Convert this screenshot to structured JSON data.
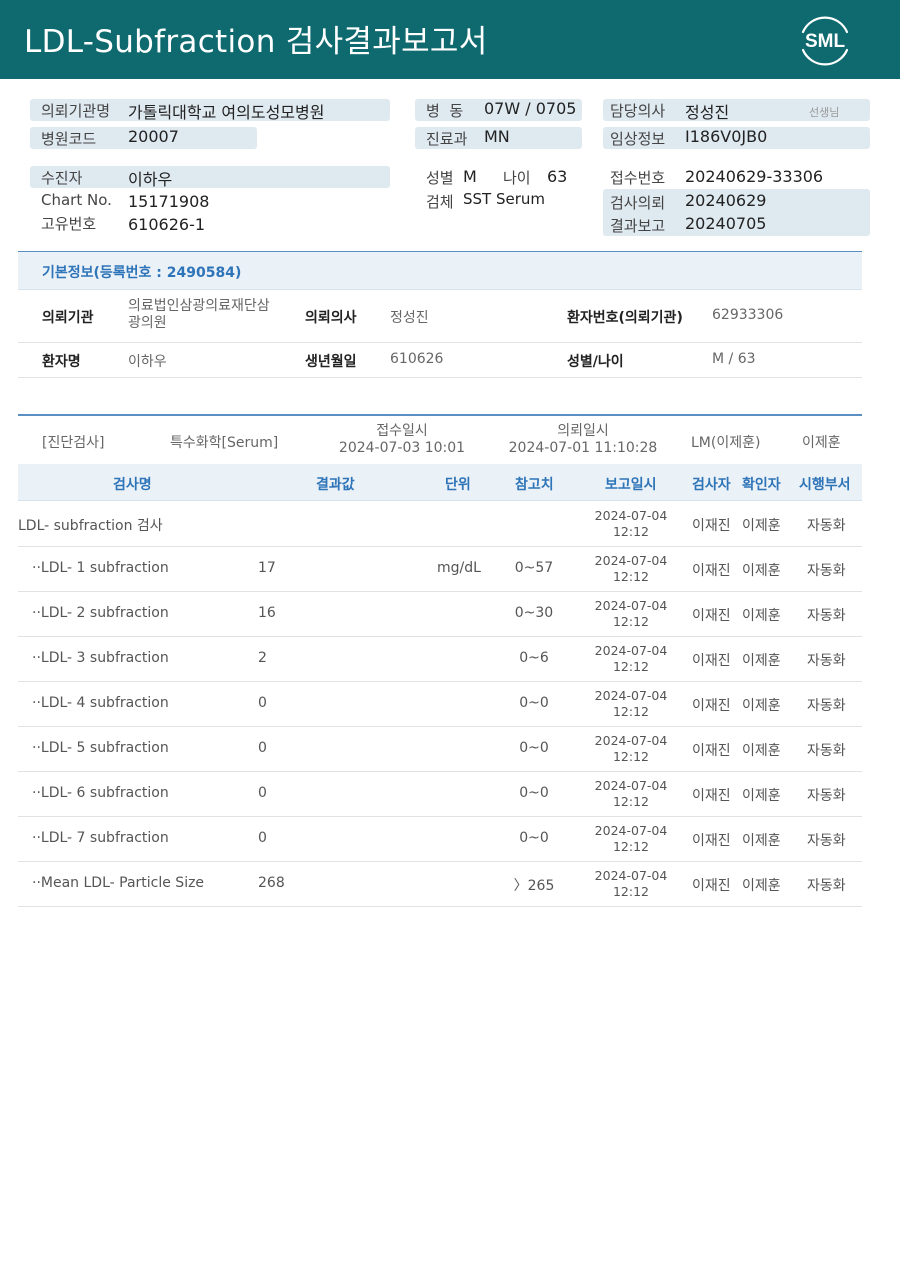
{
  "report": {
    "title": "LDL-Subfraction 검사결과보고서",
    "logo_text": "SML",
    "header_color": "#0e6a6f"
  },
  "info": {
    "hospital_label": "의뢰기관명",
    "hospital": "가톨릭대학교 여의도성모병원",
    "code_label": "병원코드",
    "code": "20007",
    "ward_label": "병  동",
    "ward": "07W / 0705",
    "dept_label": "진료과",
    "dept": "MN",
    "doctor_label": "담당의사",
    "doctor": "정성진",
    "doctor_suffix": "선생님",
    "clinical_label": "임상정보",
    "clinical": "I186V0JB0",
    "patient_label": "수진자",
    "patient": "이하우",
    "chart_label": "Chart No.",
    "chart": "15171908",
    "unique_label": "고유번호",
    "unique": "610626-1",
    "sex_label": "성별",
    "sex": "M",
    "age_label": "나이",
    "age": "63",
    "specimen_label": "검체",
    "specimen": "SST Serum",
    "receipt_label": "접수번호",
    "receipt": "20240629-33306",
    "request_label": "검사의뢰",
    "request": "20240629",
    "result_label": "결과보고",
    "result": "20240705"
  },
  "basic": {
    "header": "기본정보(등록번호 : 2490584)",
    "org_label": "의뢰기관",
    "org": "의료법인삼광의료재단삼",
    "org2": "광의원",
    "req_doc_label": "의뢰의사",
    "req_doc": "정성진",
    "pt_no_label": "환자번호(의뢰기관)",
    "pt_no": "62933306",
    "name_label": "환자명",
    "name": "이하우",
    "birth_label": "생년월일",
    "birth": "610626",
    "sexage_label": "성별/나이",
    "sexage": "M / 63"
  },
  "exam": {
    "category": "[진단검사]",
    "type": "특수화학[Serum]",
    "received_label": "접수일시",
    "received": "2024-07-03 10:01",
    "requested_label": "의뢰일시",
    "requested": "2024-07-01 11:10:28",
    "lm": "LM(이제훈)",
    "lm_name": "이제훈"
  },
  "table": {
    "headers": [
      "검사명",
      "결과값",
      "단위",
      "참고치",
      "보고일시",
      "검사자",
      "확인자",
      "시행부서"
    ],
    "rows": [
      {
        "name": "LDL- subfraction 검사",
        "result": "",
        "unit": "",
        "ref": "",
        "date": "2024-07-04",
        "time": "12:12",
        "tester": "이재진",
        "checker": "이제훈",
        "dept": "자동화"
      },
      {
        "name": "··LDL- 1 subfraction",
        "result": "17",
        "unit": "mg/dL",
        "ref": "0~57",
        "date": "2024-07-04",
        "time": "12:12",
        "tester": "이재진",
        "checker": "이제훈",
        "dept": "자동화"
      },
      {
        "name": "··LDL- 2 subfraction",
        "result": "16",
        "unit": "",
        "ref": "0~30",
        "date": "2024-07-04",
        "time": "12:12",
        "tester": "이재진",
        "checker": "이제훈",
        "dept": "자동화"
      },
      {
        "name": "··LDL- 3 subfraction",
        "result": "2",
        "unit": "",
        "ref": "0~6",
        "date": "2024-07-04",
        "time": "12:12",
        "tester": "이재진",
        "checker": "이제훈",
        "dept": "자동화"
      },
      {
        "name": "··LDL- 4 subfraction",
        "result": "0",
        "unit": "",
        "ref": "0~0",
        "date": "2024-07-04",
        "time": "12:12",
        "tester": "이재진",
        "checker": "이제훈",
        "dept": "자동화"
      },
      {
        "name": "··LDL- 5 subfraction",
        "result": "0",
        "unit": "",
        "ref": "0~0",
        "date": "2024-07-04",
        "time": "12:12",
        "tester": "이재진",
        "checker": "이제훈",
        "dept": "자동화"
      },
      {
        "name": "··LDL- 6 subfraction",
        "result": "0",
        "unit": "",
        "ref": "0~0",
        "date": "2024-07-04",
        "time": "12:12",
        "tester": "이재진",
        "checker": "이제훈",
        "dept": "자동화"
      },
      {
        "name": "··LDL- 7 subfraction",
        "result": "0",
        "unit": "",
        "ref": "0~0",
        "date": "2024-07-04",
        "time": "12:12",
        "tester": "이재진",
        "checker": "이제훈",
        "dept": "자동화"
      },
      {
        "name": "··Mean LDL- Particle Size",
        "result": "268",
        "unit": "",
        "ref": "〉265",
        "date": "2024-07-04",
        "time": "12:12",
        "tester": "이재진",
        "checker": "이제훈",
        "dept": "자동화"
      }
    ]
  }
}
